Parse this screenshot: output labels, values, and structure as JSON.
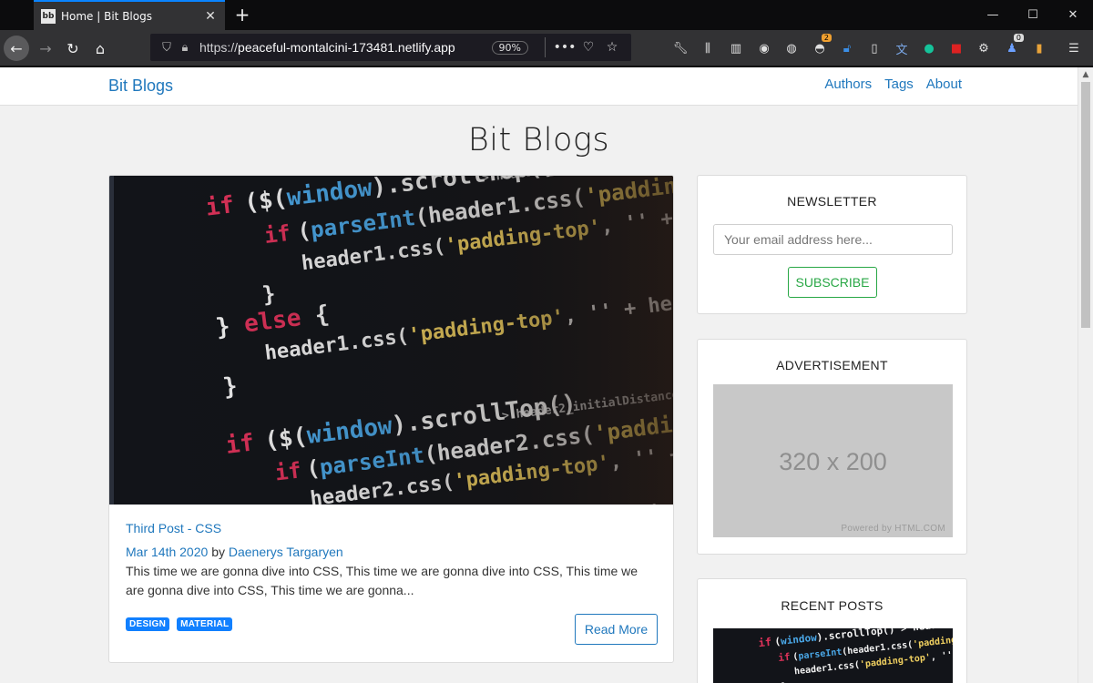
{
  "browser": {
    "tab_title": "Home | Bit Blogs",
    "favicon_text": "bb",
    "url_prefix": "https://",
    "url_host": "peaceful-montalcini-173481.netlify.app",
    "zoom": "90%",
    "extension_badge_1": "2",
    "extension_badge_2": "0"
  },
  "site": {
    "brand": "Bit Blogs",
    "nav": [
      "Authors",
      "Tags",
      "About"
    ],
    "page_title": "Bit Blogs"
  },
  "post": {
    "title": "Third Post - CSS",
    "date": "Mar 14th 2020",
    "by": "by",
    "author": "Daenerys Targaryen",
    "excerpt": "This time we are gonna dive into CSS, This time we are gonna dive into CSS, This time we are gonna dive into CSS, This time we are gonna...",
    "tags": [
      "DESIGN",
      "MATERIAL"
    ],
    "read_more": "Read More"
  },
  "sidebar": {
    "newsletter_title": "NEWSLETTER",
    "email_placeholder": "Your email address here...",
    "subscribe_label": "SUBSCRIBE",
    "ad_title": "ADVERTISEMENT",
    "ad_size": "320 x 200",
    "ad_powered": "Powered by HTML.COM",
    "recent_title": "RECENT POSTS"
  },
  "colors": {
    "link": "#2078bd",
    "tag": "#1180ff",
    "subscribe": "#28a745",
    "page_bg": "#f1f1f1"
  }
}
